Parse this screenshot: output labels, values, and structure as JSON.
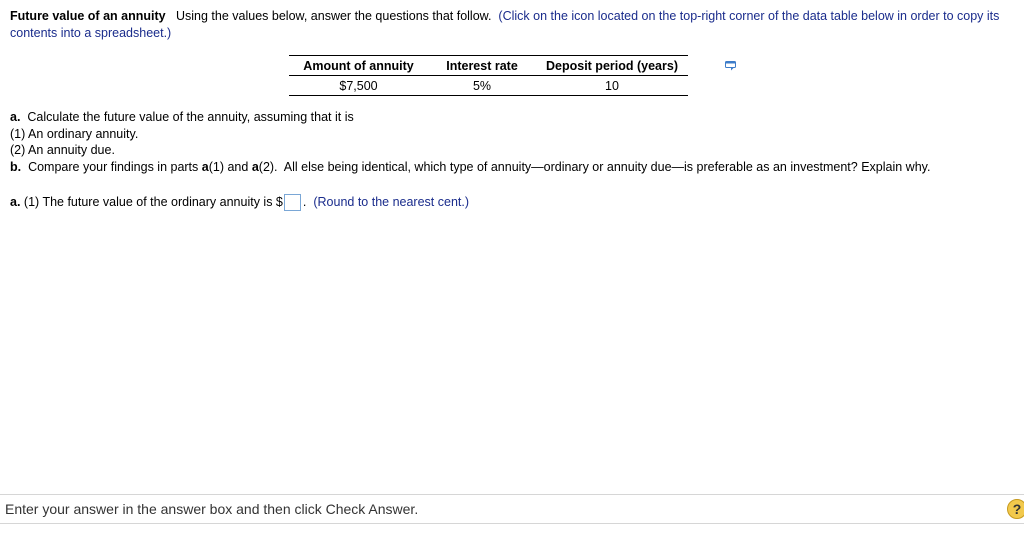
{
  "problem": {
    "heading": "Future value of an annuity",
    "instructions": "Using the values below, answer the questions that follow.",
    "copy_note": "(Click on the icon located on the top-right corner of the data table below in order to copy its contents into a spreadsheet.)"
  },
  "data_table": {
    "headers": [
      "Amount of annuity",
      "Interest rate",
      "Deposit period (years)"
    ],
    "row": [
      "$7,500",
      "5%",
      "10"
    ],
    "copy_icon": "copy-to-spreadsheet-icon"
  },
  "questions": {
    "a_label": "a.",
    "a_text": "Calculate the future value of the annuity, assuming that it is",
    "a1": "(1) An ordinary annuity.",
    "a2": "(2) An annuity due.",
    "b_label": "b.",
    "b_text_1": "Compare your findings in parts",
    "b_ref1": "a",
    "b_ref1_num": "(1) and",
    "b_ref2": "a",
    "b_ref2_num": "(2).",
    "b_text_2": "All else being identical, which type of annuity—ordinary or annuity due—is preferable as an investment? Explain why."
  },
  "answer": {
    "label_bold": "a.",
    "label": "(1)  The future value of the ordinary annuity is $",
    "value": "",
    "period": ".",
    "round_note": "(Round to the nearest cent.)"
  },
  "footer": {
    "instruction": "Enter your answer in the answer box and then click Check Answer.",
    "help_symbol": "?"
  },
  "colors": {
    "note_text": "#1a2c8c",
    "answer_box_border": "#7aa7d6",
    "help_icon": "#f2c94c"
  }
}
